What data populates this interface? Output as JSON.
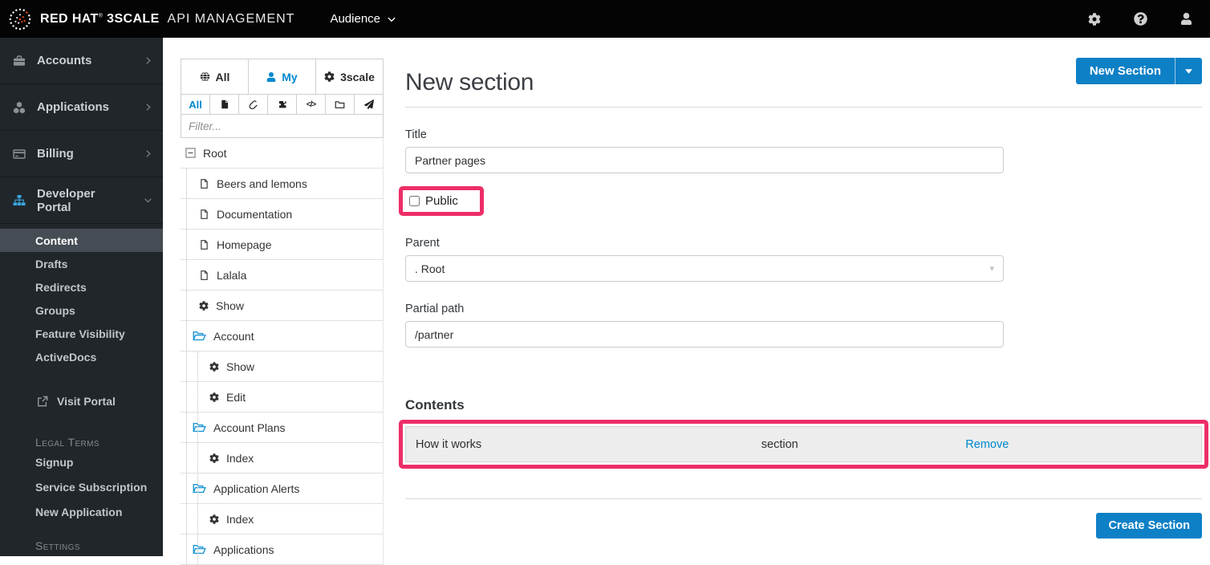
{
  "navbar": {
    "brand": {
      "name": "RED HAT",
      "registered": "®",
      "product": "3SCALE",
      "suffix": "API MANAGEMENT"
    },
    "menu": {
      "label": "Audience"
    },
    "icons": {
      "settings": "gear-icon",
      "help": "question-circle-icon",
      "account": "user-icon"
    }
  },
  "sidebar": {
    "items": [
      {
        "label": "Accounts",
        "icon": "briefcase-icon"
      },
      {
        "label": "Applications",
        "icon": "cubes-icon"
      },
      {
        "label": "Billing",
        "icon": "credit-card-icon"
      },
      {
        "label": "Developer Portal",
        "icon": "sitemap-icon",
        "expanded": true
      }
    ],
    "submenu": [
      {
        "label": "Content",
        "active": true
      },
      {
        "label": "Drafts"
      },
      {
        "label": "Redirects"
      },
      {
        "label": "Groups"
      },
      {
        "label": "Feature Visibility"
      },
      {
        "label": "ActiveDocs"
      }
    ],
    "visit_portal": {
      "label": "Visit Portal",
      "icon": "external-link-icon"
    },
    "sections": [
      {
        "header": "Legal Terms",
        "items": [
          "Signup",
          "Service Subscription",
          "New Application"
        ]
      },
      {
        "header": "Settings",
        "items": []
      }
    ]
  },
  "tree": {
    "tabs": [
      {
        "label": "All",
        "icon": "globe-icon"
      },
      {
        "label": "My",
        "icon": "user-icon",
        "active": true
      },
      {
        "label": "3scale",
        "icon": "gear-icon"
      }
    ],
    "filters": [
      {
        "label": "All",
        "active": true
      },
      {
        "icon": "page-icon"
      },
      {
        "icon": "paperclip-icon"
      },
      {
        "icon": "puzzle-icon"
      },
      {
        "icon": "code-icon"
      },
      {
        "icon": "folder-icon"
      },
      {
        "icon": "rocket-icon"
      }
    ],
    "filter_placeholder": "Filter...",
    "nodes": [
      {
        "label": "Root",
        "icon": "collapse-icon",
        "level": 0
      },
      {
        "label": "Beers and lemons",
        "icon": "file-icon",
        "level": 1
      },
      {
        "label": "Documentation",
        "icon": "file-icon",
        "level": 1
      },
      {
        "label": "Homepage",
        "icon": "file-icon",
        "level": 1
      },
      {
        "label": "Lalala",
        "icon": "file-icon",
        "level": 1
      },
      {
        "label": "Show",
        "icon": "gear-icon",
        "level": 1
      },
      {
        "label": "Account",
        "icon": "folder-open-icon",
        "level": 1
      },
      {
        "label": "Show",
        "icon": "gear-icon",
        "level": 2
      },
      {
        "label": "Edit",
        "icon": "gear-icon",
        "level": 2
      },
      {
        "label": "Account Plans",
        "icon": "folder-open-icon",
        "level": 1
      },
      {
        "label": "Index",
        "icon": "gear-icon",
        "level": 2
      },
      {
        "label": "Application Alerts",
        "icon": "folder-open-icon",
        "level": 1
      },
      {
        "label": "Index",
        "icon": "gear-icon",
        "level": 2
      },
      {
        "label": "Applications",
        "icon": "folder-open-icon",
        "level": 1
      }
    ]
  },
  "main": {
    "title": "New section",
    "new_section_button": "New Section",
    "form": {
      "title_label": "Title",
      "title_value": "Partner pages",
      "public_label": "Public",
      "public_checked": false,
      "parent_label": "Parent",
      "parent_value": ". Root",
      "partial_path_label": "Partial path",
      "partial_path_value": "/partner"
    },
    "contents": {
      "heading": "Contents",
      "rows": [
        {
          "name": "How it works",
          "type": "section",
          "action": "Remove"
        }
      ]
    },
    "create_button": "Create Section"
  },
  "colors": {
    "accent": "#0088ce",
    "button_blue": "#0e80c6",
    "annotation_pink": "#ed2e67",
    "navbar_bg": "#040404",
    "sidebar_bg": "#21262b"
  }
}
